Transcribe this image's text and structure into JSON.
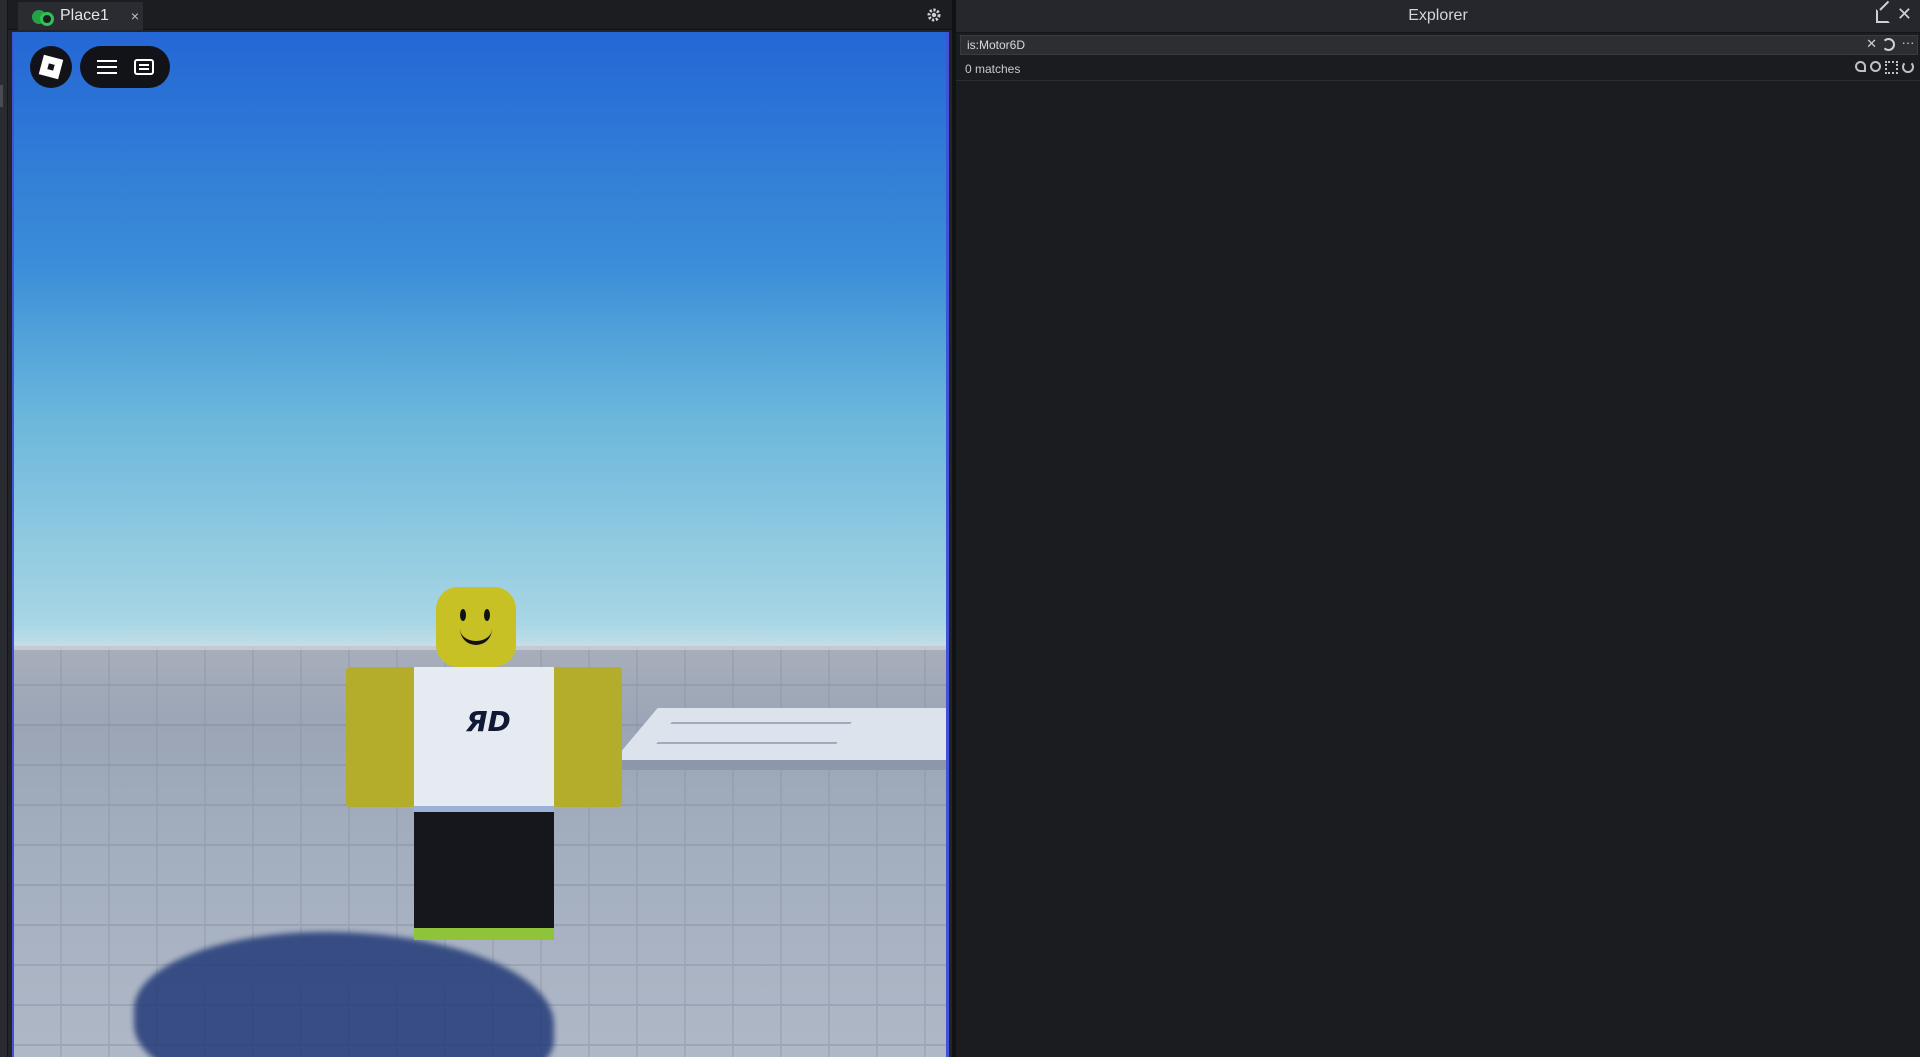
{
  "viewport": {
    "tab": {
      "label": "Place1",
      "close_glyph": "×"
    },
    "overlay": {
      "roblox_button_icon": "roblox-logo-icon",
      "menu_icon": "hamburger-icon",
      "chat_icon": "chat-icon"
    },
    "character_shirt_logo": "ЯD"
  },
  "explorer": {
    "title": "Explorer",
    "close_glyph": "✕",
    "search": {
      "value": "is:Motor6D",
      "clear_glyph": "✕",
      "more_glyph": "···"
    },
    "matches_text": "0 matches",
    "match_tool_icons": [
      "match-case-icon",
      "match-word-icon",
      "select-all-icon",
      "refresh-icon"
    ]
  },
  "colors": {
    "accent_border": "#4353d8",
    "panel_bg": "#1b1c20",
    "header_bg": "#26272c"
  }
}
